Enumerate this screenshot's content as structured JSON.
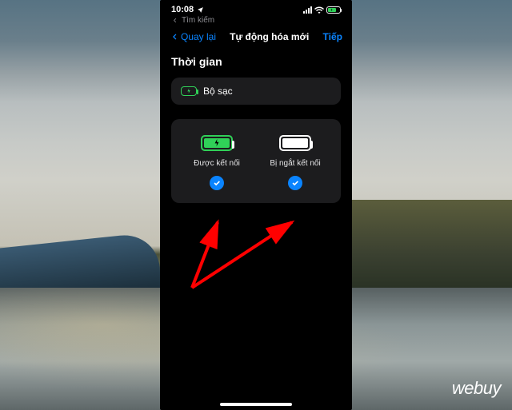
{
  "status_bar": {
    "time": "10:08",
    "location_icon": "location-arrow",
    "search_label": "Tìm kiếm"
  },
  "nav": {
    "back_label": "Quay lại",
    "title": "Tự động hóa mới",
    "next_label": "Tiếp"
  },
  "section": {
    "title": "Thời gian",
    "charger_label": "Bộ sạc"
  },
  "options": {
    "connected": {
      "label": "Được kết nối",
      "checked": true
    },
    "disconnected": {
      "label": "Bị ngắt kết nối",
      "checked": true
    }
  },
  "watermark": "webuy",
  "colors": {
    "accent": "#0a84ff",
    "green": "#30d158",
    "card": "#1c1c1e"
  }
}
